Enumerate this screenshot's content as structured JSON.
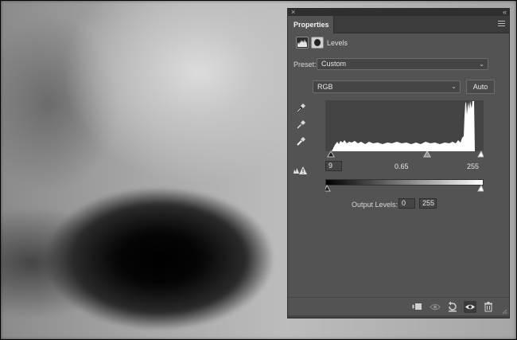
{
  "panel": {
    "tab_label": "Properties",
    "close_glyph": "×",
    "collapse_glyph": "«"
  },
  "adjustment": {
    "title": "Levels",
    "icon": "levels-histogram-icon",
    "mask_icon": "layer-mask-icon"
  },
  "preset": {
    "label": "Preset:",
    "value": "Custom"
  },
  "channel": {
    "value": "RGB",
    "auto_label": "Auto"
  },
  "input_levels": {
    "black": "9",
    "gamma": "0.65",
    "white": "255"
  },
  "output_levels": {
    "label": "Output Levels:",
    "black": "0",
    "white": "255"
  },
  "footer_icons": [
    "clip-to-layer-icon",
    "view-previous-state-icon",
    "reset-icon",
    "visibility-eye-icon",
    "trash-icon"
  ],
  "colors": {
    "panel_bg": "#535353",
    "histogram_bg": "#444444",
    "histogram_fill": "#ffffff"
  }
}
